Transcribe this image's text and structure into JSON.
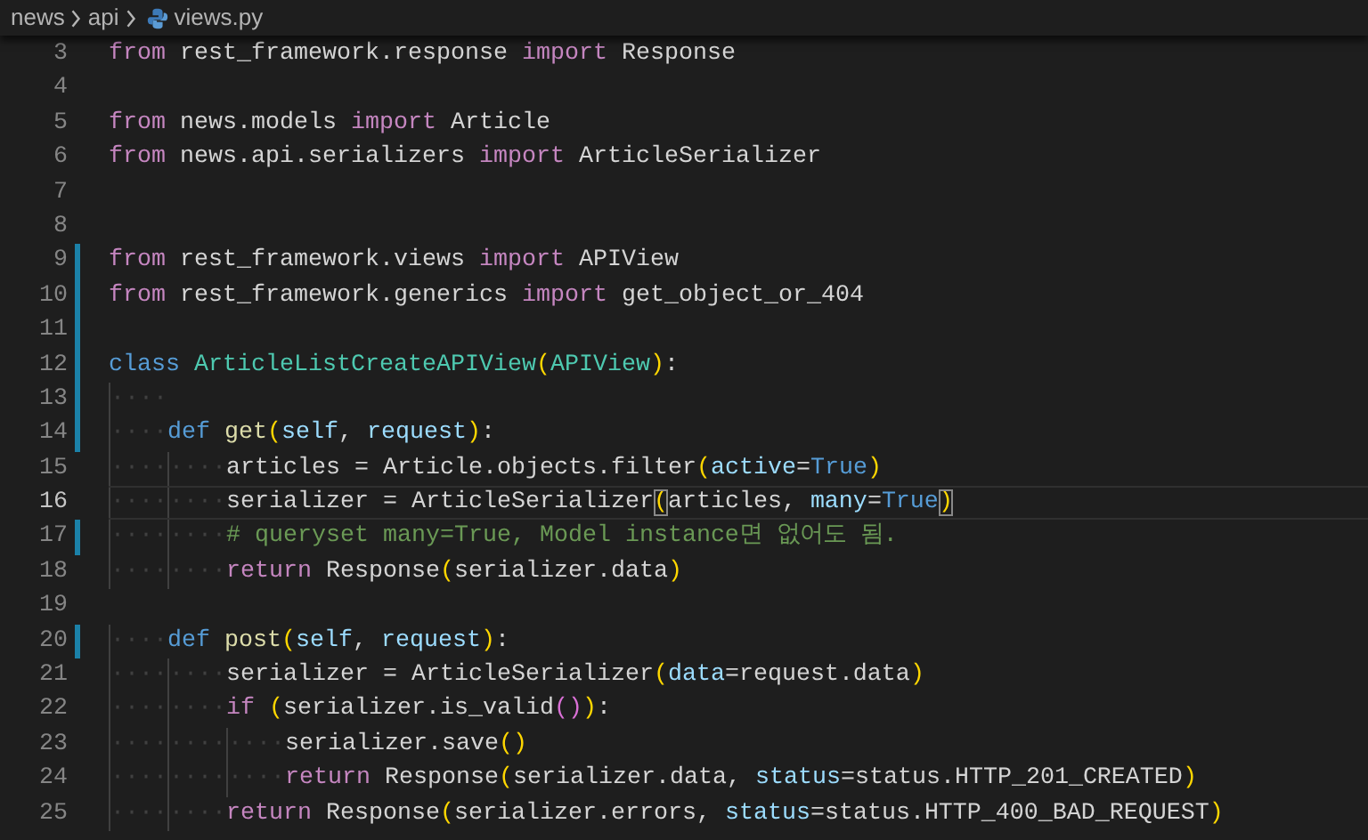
{
  "breadcrumb": {
    "items": [
      {
        "label": "news",
        "kind": "folder"
      },
      {
        "label": "api",
        "kind": "folder"
      },
      {
        "label": "views.py",
        "kind": "python-file"
      }
    ]
  },
  "editor": {
    "lines": [
      {
        "number": "3",
        "modified": false,
        "current": false,
        "tokens": [
          {
            "kind": "keyword",
            "text": "from"
          },
          {
            "kind": "plain",
            "text": " rest_framework.response "
          },
          {
            "kind": "keyword",
            "text": "import"
          },
          {
            "kind": "plain",
            "text": " Response"
          }
        ]
      },
      {
        "number": "4",
        "modified": false,
        "current": false
      },
      {
        "number": "5",
        "modified": false,
        "current": false,
        "tokens": [
          {
            "kind": "keyword",
            "text": "from"
          },
          {
            "kind": "plain",
            "text": " news.models "
          },
          {
            "kind": "keyword",
            "text": "import"
          },
          {
            "kind": "plain",
            "text": " Article"
          }
        ]
      },
      {
        "number": "6",
        "modified": false,
        "current": false,
        "tokens": [
          {
            "kind": "keyword",
            "text": "from"
          },
          {
            "kind": "plain",
            "text": " news.api.serializers "
          },
          {
            "kind": "keyword",
            "text": "import"
          },
          {
            "kind": "plain",
            "text": " ArticleSerializer"
          }
        ]
      },
      {
        "number": "7",
        "modified": false,
        "current": false
      },
      {
        "number": "8",
        "modified": false,
        "current": false
      },
      {
        "number": "9",
        "modified": true,
        "current": false,
        "tokens": [
          {
            "kind": "keyword",
            "text": "from"
          },
          {
            "kind": "plain",
            "text": " rest_framework.views "
          },
          {
            "kind": "keyword",
            "text": "import"
          },
          {
            "kind": "plain",
            "text": " APIView"
          }
        ]
      },
      {
        "number": "10",
        "modified": true,
        "current": false,
        "tokens": [
          {
            "kind": "keyword",
            "text": "from"
          },
          {
            "kind": "plain",
            "text": " rest_framework.generics "
          },
          {
            "kind": "keyword",
            "text": "import"
          },
          {
            "kind": "plain",
            "text": " get_object_or_404"
          }
        ]
      },
      {
        "number": "11",
        "modified": true,
        "current": false
      },
      {
        "number": "12",
        "modified": true,
        "current": false,
        "tokens": [
          {
            "kind": "storage",
            "text": "class "
          },
          {
            "kind": "class",
            "text": "ArticleListCreateAPIView"
          },
          {
            "kind": "bracket",
            "text": "(",
            "matched": false
          },
          {
            "kind": "class",
            "text": "APIView"
          },
          {
            "kind": "bracket",
            "text": ")",
            "matched": false
          },
          {
            "kind": "plain",
            "text": ":"
          }
        ]
      },
      {
        "number": "13",
        "modified": true,
        "current": false,
        "tokens": [
          {
            "kind": "whitespace",
            "text": "····"
          }
        ]
      },
      {
        "number": "14",
        "modified": true,
        "current": false,
        "tokens": [
          {
            "kind": "whitespace",
            "text": "····"
          },
          {
            "kind": "storage",
            "text": "def "
          },
          {
            "kind": "function",
            "text": "get"
          },
          {
            "kind": "bracket",
            "text": "(",
            "matched": false
          },
          {
            "kind": "param",
            "text": "self"
          },
          {
            "kind": "plain",
            "text": ", "
          },
          {
            "kind": "param",
            "text": "request"
          },
          {
            "kind": "bracket",
            "text": ")",
            "matched": false
          },
          {
            "kind": "plain",
            "text": ":"
          }
        ]
      },
      {
        "number": "15",
        "modified": false,
        "current": false,
        "tokens": [
          {
            "kind": "whitespace",
            "text": "········"
          },
          {
            "kind": "plain",
            "text": "articles = Article.objects.filter"
          },
          {
            "kind": "bracket",
            "text": "(",
            "matched": false
          },
          {
            "kind": "param",
            "text": "active"
          },
          {
            "kind": "plain",
            "text": "="
          },
          {
            "kind": "constant",
            "text": "True"
          },
          {
            "kind": "bracket",
            "text": ")",
            "matched": false
          }
        ]
      },
      {
        "number": "16",
        "modified": false,
        "current": true,
        "tokens": [
          {
            "kind": "whitespace",
            "text": "········"
          },
          {
            "kind": "plain",
            "text": "serializer = ArticleSerializer"
          },
          {
            "kind": "bracket",
            "text": "(",
            "matched": true
          },
          {
            "kind": "plain",
            "text": "articles, "
          },
          {
            "kind": "param",
            "text": "many"
          },
          {
            "kind": "plain",
            "text": "="
          },
          {
            "kind": "constant",
            "text": "True"
          },
          {
            "kind": "bracket",
            "text": ")",
            "matched": true
          }
        ]
      },
      {
        "number": "17",
        "modified": true,
        "current": false,
        "tokens": [
          {
            "kind": "whitespace",
            "text": "········"
          },
          {
            "kind": "comment",
            "text": "# queryset many=True, Model instance면 없어도 됨."
          }
        ]
      },
      {
        "number": "18",
        "modified": false,
        "current": false,
        "tokens": [
          {
            "kind": "whitespace",
            "text": "········"
          },
          {
            "kind": "keyword",
            "text": "return"
          },
          {
            "kind": "plain",
            "text": " Response"
          },
          {
            "kind": "bracket",
            "text": "(",
            "matched": false
          },
          {
            "kind": "plain",
            "text": "serializer.data"
          },
          {
            "kind": "bracket",
            "text": ")",
            "matched": false
          }
        ]
      },
      {
        "number": "19",
        "modified": false,
        "current": false
      },
      {
        "number": "20",
        "modified": true,
        "current": false,
        "tokens": [
          {
            "kind": "whitespace",
            "text": "····"
          },
          {
            "kind": "storage",
            "text": "def "
          },
          {
            "kind": "function",
            "text": "post"
          },
          {
            "kind": "bracket",
            "text": "(",
            "matched": false
          },
          {
            "kind": "param",
            "text": "self"
          },
          {
            "kind": "plain",
            "text": ", "
          },
          {
            "kind": "param",
            "text": "request"
          },
          {
            "kind": "bracket",
            "text": ")",
            "matched": false
          },
          {
            "kind": "plain",
            "text": ":"
          }
        ]
      },
      {
        "number": "21",
        "modified": false,
        "current": false,
        "tokens": [
          {
            "kind": "whitespace",
            "text": "········"
          },
          {
            "kind": "plain",
            "text": "serializer = ArticleSerializer"
          },
          {
            "kind": "bracket",
            "text": "(",
            "matched": false
          },
          {
            "kind": "param",
            "text": "data"
          },
          {
            "kind": "plain",
            "text": "=request.data"
          },
          {
            "kind": "bracket",
            "text": ")",
            "matched": false
          }
        ]
      },
      {
        "number": "22",
        "modified": false,
        "current": false,
        "tokens": [
          {
            "kind": "whitespace",
            "text": "········"
          },
          {
            "kind": "keyword",
            "text": "if "
          },
          {
            "kind": "bracket",
            "text": "(",
            "matched": false
          },
          {
            "kind": "plain",
            "text": "serializer.is_valid"
          },
          {
            "kind": "inner-bracket",
            "text": "()",
            "matched": false
          },
          {
            "kind": "bracket",
            "text": ")",
            "matched": false
          },
          {
            "kind": "plain",
            "text": ":"
          }
        ]
      },
      {
        "number": "23",
        "modified": false,
        "current": false,
        "tokens": [
          {
            "kind": "whitespace",
            "text": "············"
          },
          {
            "kind": "plain",
            "text": "serializer.save"
          },
          {
            "kind": "bracket",
            "text": "()",
            "matched": false
          }
        ]
      },
      {
        "number": "24",
        "modified": false,
        "current": false,
        "tokens": [
          {
            "kind": "whitespace",
            "text": "············"
          },
          {
            "kind": "keyword",
            "text": "return"
          },
          {
            "kind": "plain",
            "text": " Response"
          },
          {
            "kind": "bracket",
            "text": "(",
            "matched": false
          },
          {
            "kind": "plain",
            "text": "serializer.data, "
          },
          {
            "kind": "param",
            "text": "status"
          },
          {
            "kind": "plain",
            "text": "=status.HTTP_201_CREATED"
          },
          {
            "kind": "bracket",
            "text": ")",
            "matched": false
          }
        ]
      },
      {
        "number": "25",
        "modified": false,
        "current": false,
        "tokens": [
          {
            "kind": "whitespace",
            "text": "········"
          },
          {
            "kind": "keyword",
            "text": "return"
          },
          {
            "kind": "plain",
            "text": " Response"
          },
          {
            "kind": "bracket",
            "text": "(",
            "matched": false
          },
          {
            "kind": "plain",
            "text": "serializer.errors, "
          },
          {
            "kind": "param",
            "text": "status"
          },
          {
            "kind": "plain",
            "text": "=status.HTTP_400_BAD_REQUEST"
          },
          {
            "kind": "bracket",
            "text": ")",
            "matched": false
          }
        ]
      }
    ]
  }
}
